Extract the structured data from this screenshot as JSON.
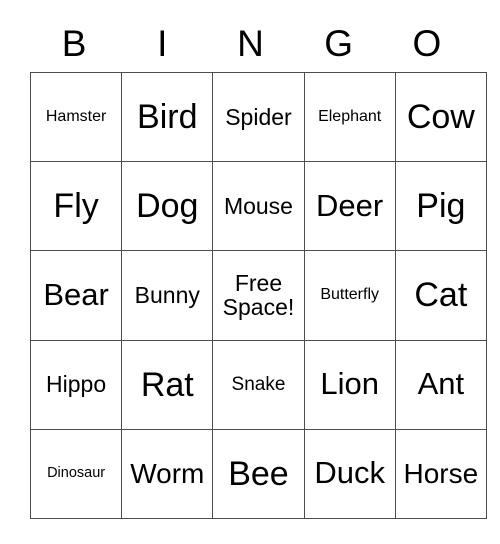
{
  "card": {
    "headers": [
      "B",
      "I",
      "N",
      "G",
      "O"
    ],
    "rows": [
      [
        {
          "label": "Hamster",
          "size": "xs"
        },
        {
          "label": "Bird",
          "size": "xxl"
        },
        {
          "label": "Spider",
          "size": "m"
        },
        {
          "label": "Elephant",
          "size": "xs"
        },
        {
          "label": "Cow",
          "size": "xxl"
        }
      ],
      [
        {
          "label": "Fly",
          "size": "xxl"
        },
        {
          "label": "Dog",
          "size": "xxl"
        },
        {
          "label": "Mouse",
          "size": "m"
        },
        {
          "label": "Deer",
          "size": "xl"
        },
        {
          "label": "Pig",
          "size": "xxl"
        }
      ],
      [
        {
          "label": "Bear",
          "size": "xl"
        },
        {
          "label": "Bunny",
          "size": "m"
        },
        {
          "label": "Free\nSpace!",
          "size": "m"
        },
        {
          "label": "Butterfly",
          "size": "xs"
        },
        {
          "label": "Cat",
          "size": "xxl"
        }
      ],
      [
        {
          "label": "Hippo",
          "size": "m"
        },
        {
          "label": "Rat",
          "size": "xxl"
        },
        {
          "label": "Snake",
          "size": "s"
        },
        {
          "label": "Lion",
          "size": "xl"
        },
        {
          "label": "Ant",
          "size": "xl"
        }
      ],
      [
        {
          "label": "Dinosaur",
          "size": "xxs"
        },
        {
          "label": "Worm",
          "size": "l"
        },
        {
          "label": "Bee",
          "size": "xxl"
        },
        {
          "label": "Duck",
          "size": "xl"
        },
        {
          "label": "Horse",
          "size": "l"
        }
      ]
    ],
    "colors": {
      "background": "#ffffff",
      "text": "#000000",
      "border": "#4d4d4d"
    }
  }
}
